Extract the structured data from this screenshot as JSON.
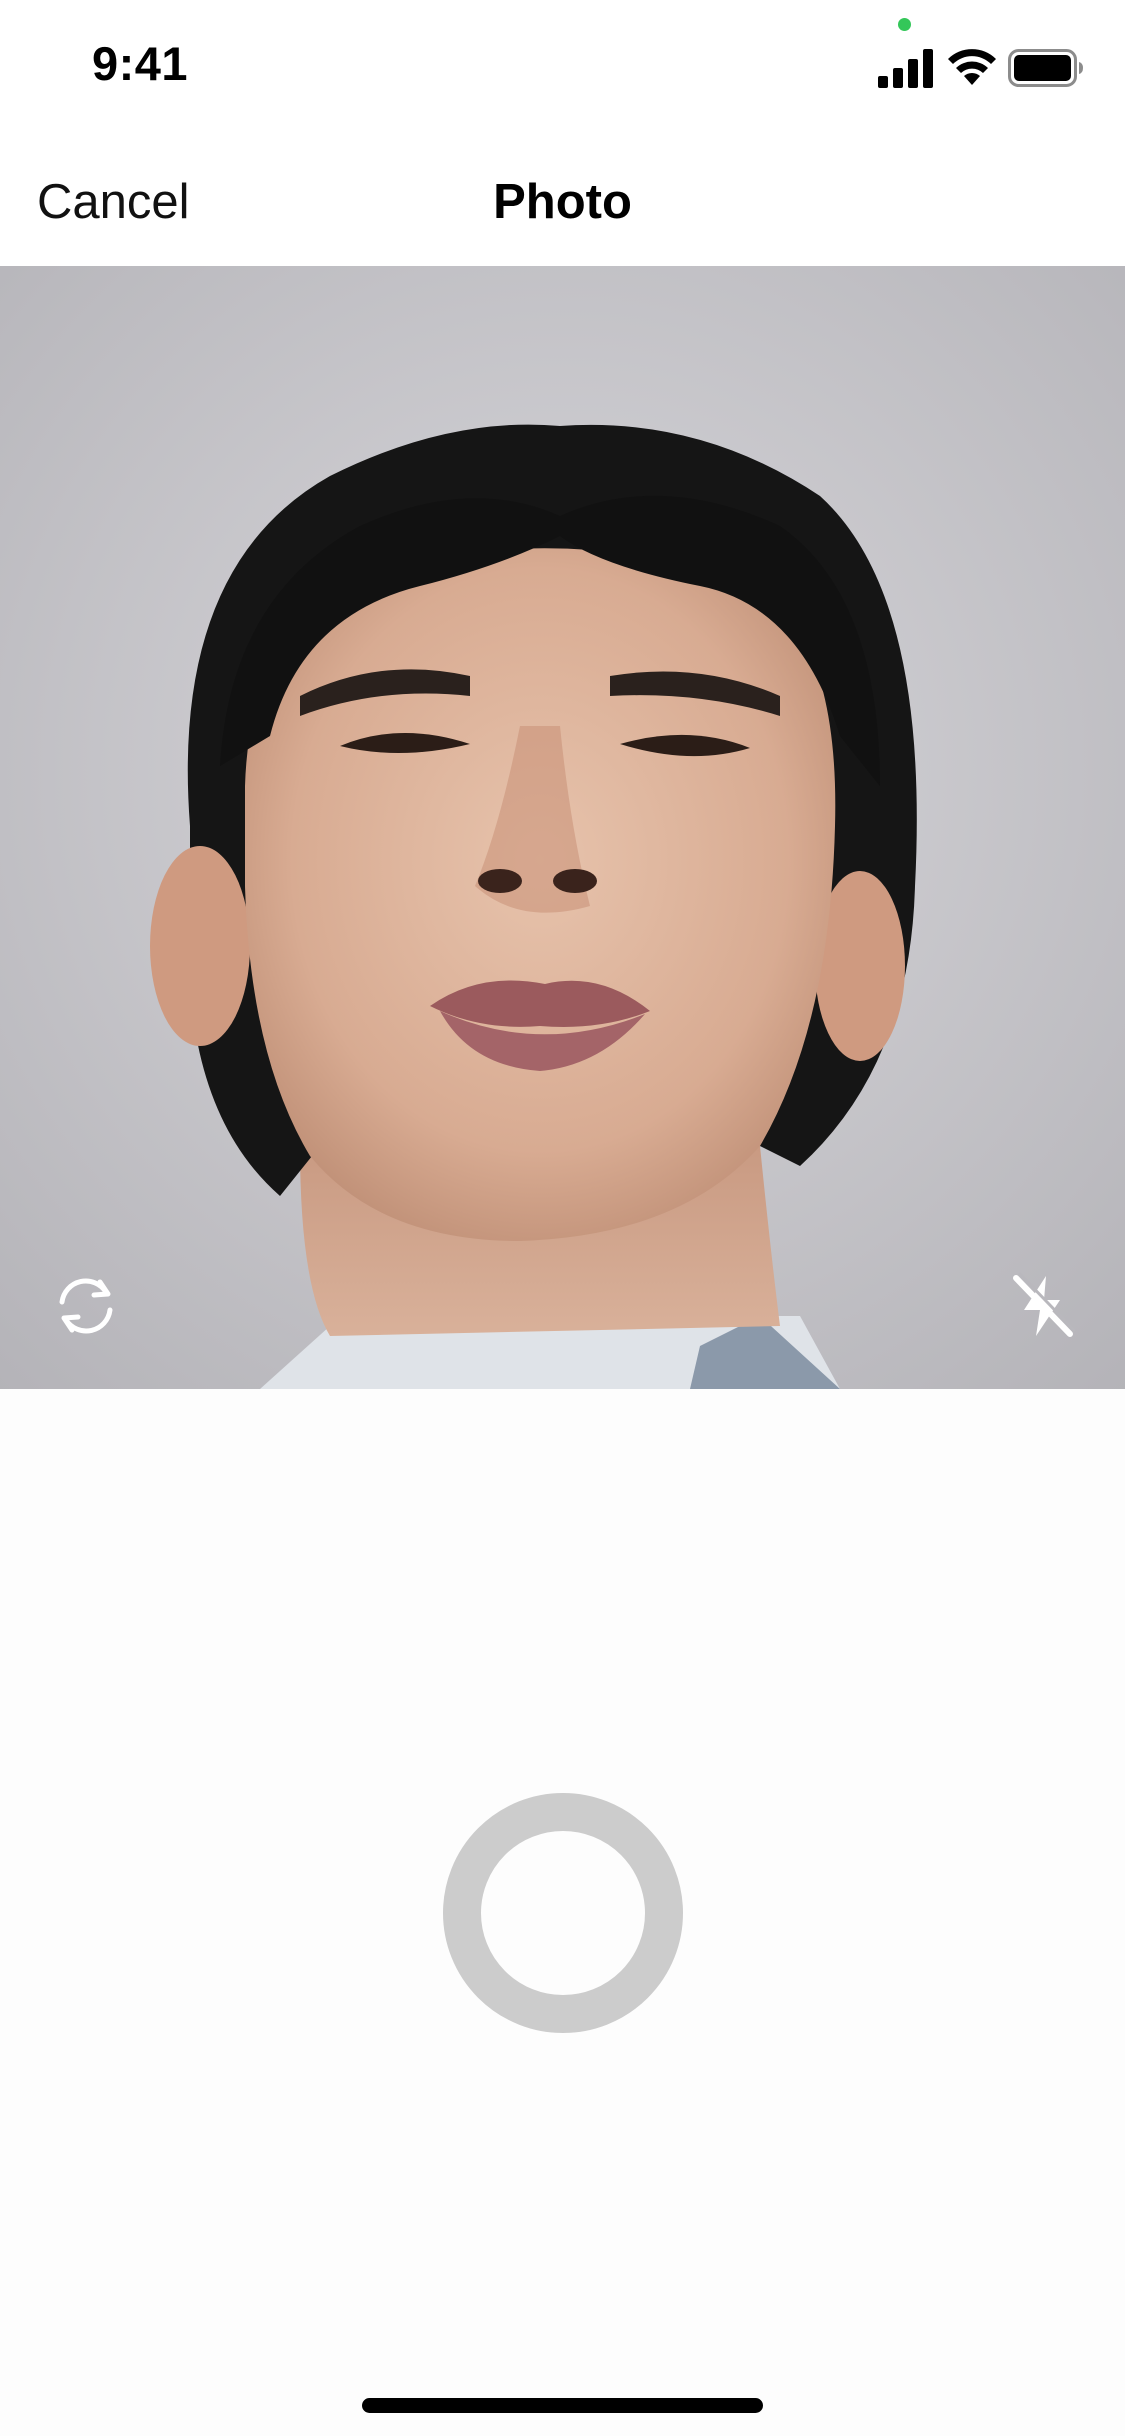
{
  "status_bar": {
    "time": "9:41",
    "icons": [
      "cellular-signal-icon",
      "wifi-icon",
      "battery-icon"
    ],
    "privacy_indicator_color": "#34c759"
  },
  "nav": {
    "cancel_label": "Cancel",
    "title": "Photo"
  },
  "camera": {
    "flip_icon": "flip-camera-icon",
    "flash_icon": "flash-off-icon"
  },
  "controls": {
    "shutter_icon": "shutter-button",
    "shutter_ring_color": "#cccccc"
  }
}
